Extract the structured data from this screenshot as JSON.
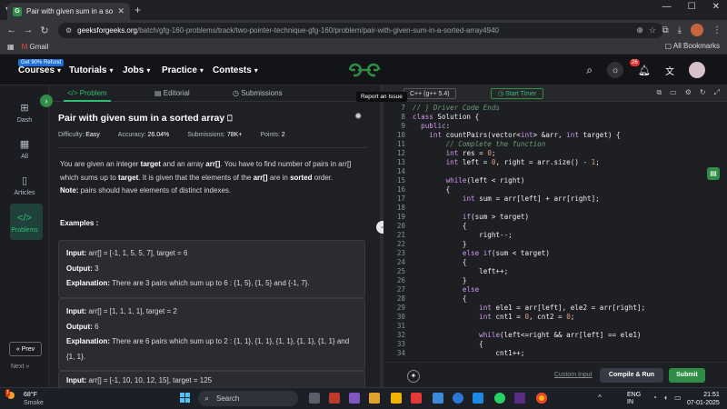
{
  "browser": {
    "tab_title": "Pair with given sum in a sorted",
    "tab_favicon": "GfG",
    "url_domain": "geeksforgeeks.org",
    "url_path": "/batch/gfg-160-problems/track/two-pointer-technique-gfg-160/problem/pair-with-given-sum-in-a-sorted-array4940",
    "bookmark_gmail": "Gmail",
    "bookmarks_all": "All Bookmarks"
  },
  "header": {
    "badge": "Get 90% Refund",
    "nav": [
      {
        "label": "Courses"
      },
      {
        "label": "Tutorials"
      },
      {
        "label": "Jobs"
      },
      {
        "label": "Practice"
      },
      {
        "label": "Contests"
      }
    ],
    "notification_count": "26"
  },
  "sidebar": {
    "items": [
      {
        "label": "Dash",
        "icon": "dashboard-icon"
      },
      {
        "label": "All",
        "icon": "grid-icon"
      },
      {
        "label": "Articles",
        "icon": "book-icon"
      },
      {
        "label": "Problems",
        "icon": "code-icon"
      }
    ],
    "prev_label": "Prev",
    "next_label": "Next"
  },
  "problem": {
    "tabs": [
      "Problem",
      "Editorial",
      "Submissions"
    ],
    "title": "Pair with given sum in a sorted array",
    "difficulty_label": "Difficulty:",
    "difficulty": "Easy",
    "accuracy_label": "Accuracy:",
    "accuracy": "26.04%",
    "submissions_label": "Submissions:",
    "submissions": "78K+",
    "points_label": "Points:",
    "points": "2",
    "desc_1": "You are given an integer",
    "desc_target": "target",
    "desc_2": "and an array",
    "desc_arr": "arr[]",
    "desc_3": ". You have to find number of pairs in arr[] which sums up to",
    "desc_4": ". It is given that the elements of the",
    "desc_5": "are in",
    "desc_sorted": "sorted",
    "desc_6": "order.",
    "note_label": "Note:",
    "note_text": "pairs should have elements of distinct indexes.",
    "examples_heading": "Examples :",
    "examples": [
      {
        "input": "arr[] = [-1, 1, 5, 5, 7], target = 6",
        "output": "3",
        "explanation": "There are 3 pairs which sum up to 6 : {1, 5}, {1, 5} and {-1, 7}."
      },
      {
        "input": "arr[] = [1, 1, 1, 1], target = 2",
        "output": "6",
        "explanation": "There are 6 pairs which sum up to 2 : {1, 1}, {1, 1}, {1, 1}, {1, 1}, {1, 1} and {1, 1}."
      },
      {
        "input": "arr[] = [-1, 10, 10, 12, 15], target = 125"
      }
    ],
    "input_label": "Input:",
    "output_label": "Output:",
    "explanation_label": "Explanation:"
  },
  "editor": {
    "language": "C++ (g++ 5.4)",
    "timer_label": "Start Timer",
    "tooltip": "Report an Issue",
    "custom_input": "Custom Input",
    "compile_run": "Compile & Run",
    "submit": "Submit"
  },
  "code_lines": [
    {
      "n": "7",
      "t": "// } Driver Code Ends"
    },
    {
      "n": "8",
      "t": "class Solution {"
    },
    {
      "n": "9",
      "t": "  public:"
    },
    {
      "n": "10",
      "t": "    int countPairs(vector<int> &arr, int target) {"
    },
    {
      "n": "11",
      "t": "        // Complete the function"
    },
    {
      "n": "12",
      "t": "        int res = 0;"
    },
    {
      "n": "13",
      "t": "        int left = 0, right = arr.size() - 1;"
    },
    {
      "n": "14",
      "t": ""
    },
    {
      "n": "15",
      "t": "        while(left < right)"
    },
    {
      "n": "16",
      "t": "        {"
    },
    {
      "n": "17",
      "t": "            int sum = arr[left] + arr[right];"
    },
    {
      "n": "18",
      "t": ""
    },
    {
      "n": "19",
      "t": "            if(sum > target)"
    },
    {
      "n": "20",
      "t": "            {"
    },
    {
      "n": "21",
      "t": "                right--;"
    },
    {
      "n": "22",
      "t": "            }"
    },
    {
      "n": "23",
      "t": "            else if(sum < target)"
    },
    {
      "n": "24",
      "t": "            {"
    },
    {
      "n": "25",
      "t": "                left++;"
    },
    {
      "n": "26",
      "t": "            }"
    },
    {
      "n": "27",
      "t": "            else"
    },
    {
      "n": "28",
      "t": "            {"
    },
    {
      "n": "29",
      "t": "                int ele1 = arr[left], ele2 = arr[right];"
    },
    {
      "n": "30",
      "t": "                int cnt1 = 0, cnt2 = 0;"
    },
    {
      "n": "31",
      "t": ""
    },
    {
      "n": "32",
      "t": "                while(left<=right && arr[left] == ele1)"
    },
    {
      "n": "33",
      "t": "                {"
    },
    {
      "n": "34",
      "t": "                    cnt1++;"
    }
  ],
  "taskbar": {
    "weather_temp": "68°F",
    "weather_desc": "Smoke",
    "weather_badge": "1",
    "search_label": "Search",
    "lang": "ENG",
    "region": "IN",
    "time": "21:51",
    "date": "07-01-2025"
  },
  "colors": {
    "accent_green": "#2f8d46",
    "link_green": "#2fbf71",
    "keyword": "#d09af0",
    "comment": "#6b9c74"
  }
}
